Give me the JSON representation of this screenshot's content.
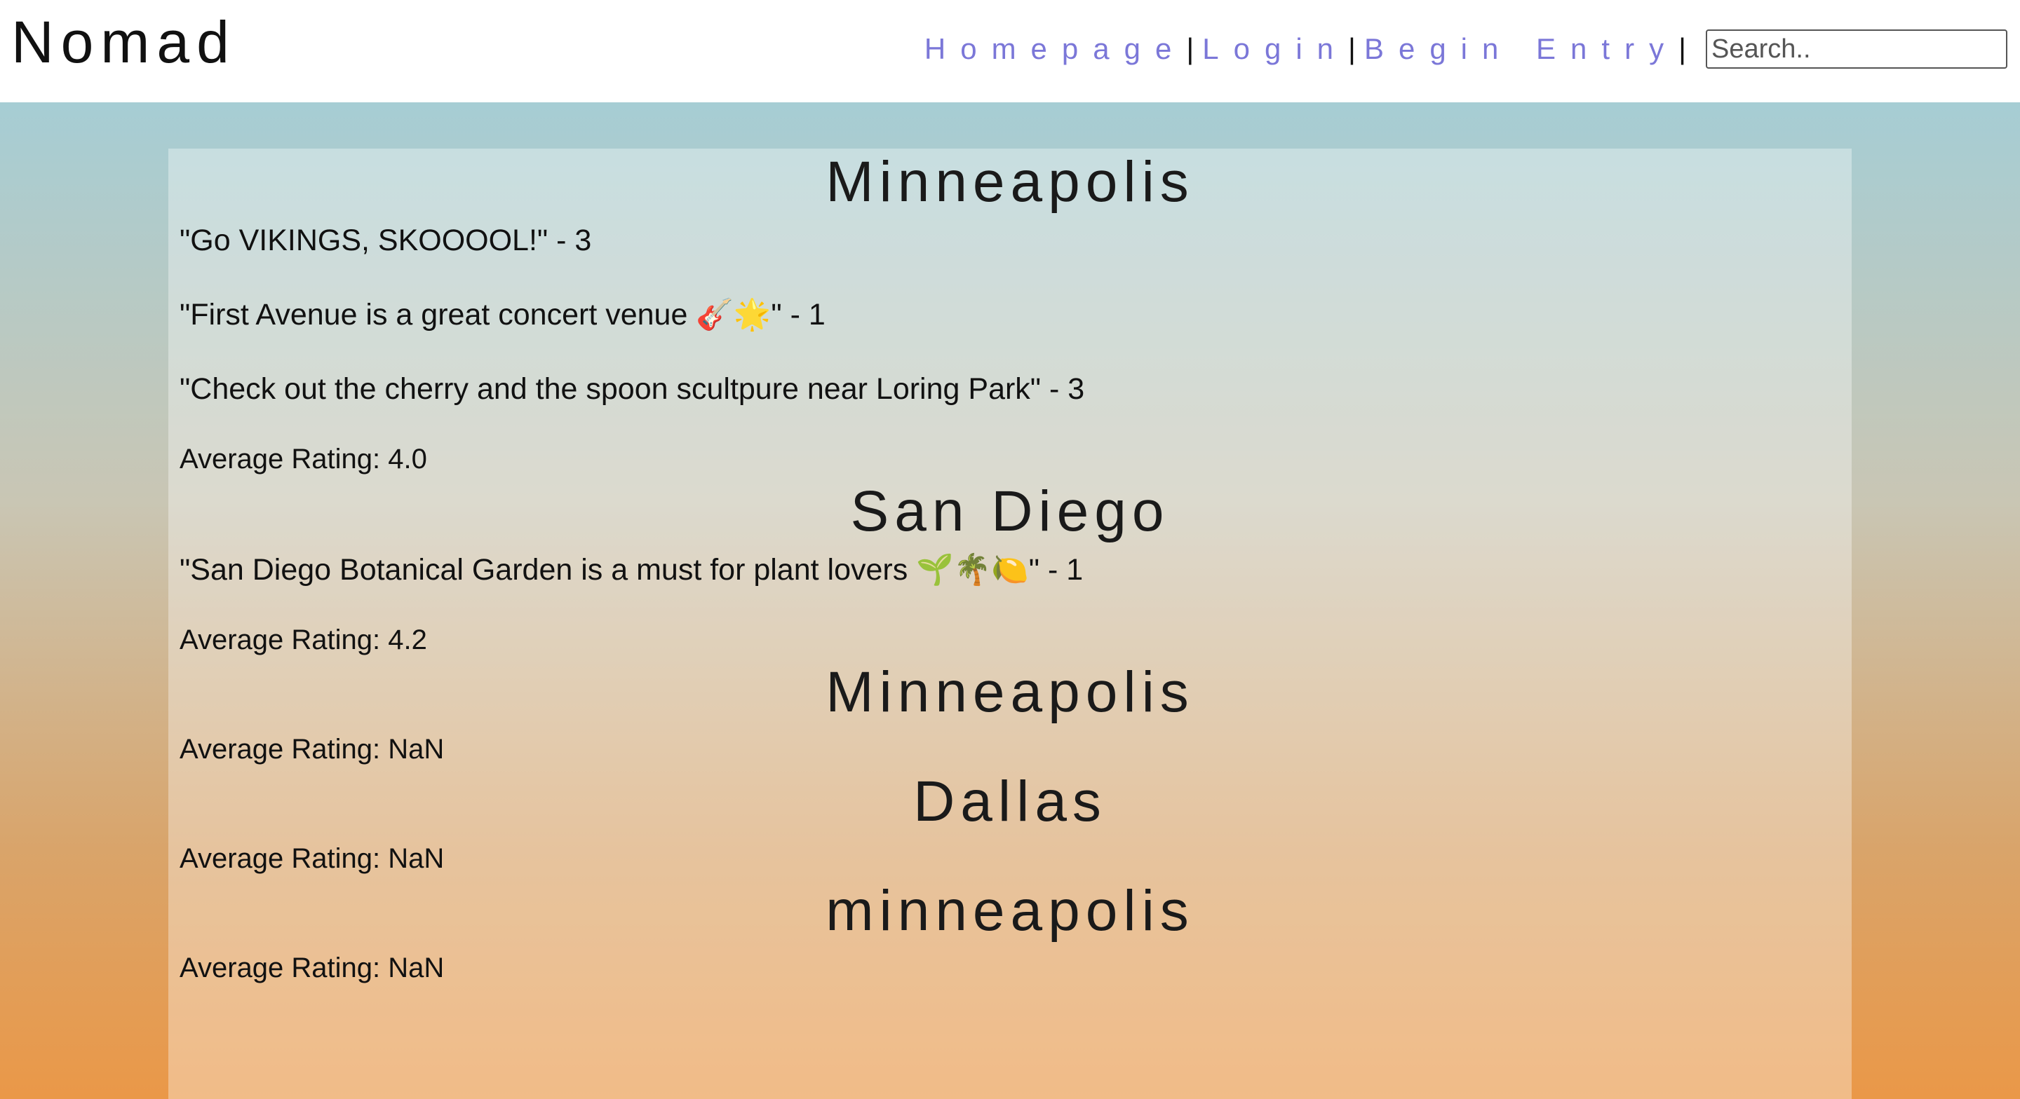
{
  "header": {
    "logo": "Nomad",
    "nav": {
      "homepage": "Homepage",
      "login": "Login",
      "begin_entry": "Begin Entry",
      "separator": "|"
    },
    "search_placeholder": "Search.."
  },
  "cities": [
    {
      "name": "Minneapolis",
      "reviews": [
        "\"Go VIKINGS, SKOOOOL!\" - 3",
        "\"First Avenue is a great concert venue 🎸🌟\" - 1",
        "\"Check out the cherry and the spoon scultpure near Loring Park\" - 3"
      ],
      "average": "Average Rating: 4.0"
    },
    {
      "name": "San Diego",
      "reviews": [
        "\"San Diego Botanical Garden is a must for plant lovers 🌱🌴🍋\" - 1"
      ],
      "average": "Average Rating: 4.2"
    },
    {
      "name": "Minneapolis",
      "reviews": [],
      "average": "Average Rating: NaN"
    },
    {
      "name": "Dallas",
      "reviews": [],
      "average": "Average Rating: NaN"
    },
    {
      "name": "minneapolis",
      "reviews": [],
      "average": "Average Rating: NaN"
    }
  ],
  "colors": {
    "nav_link": "#7b77d8",
    "gradient_top": "#a6cdd4",
    "gradient_bottom": "#ea9848"
  }
}
